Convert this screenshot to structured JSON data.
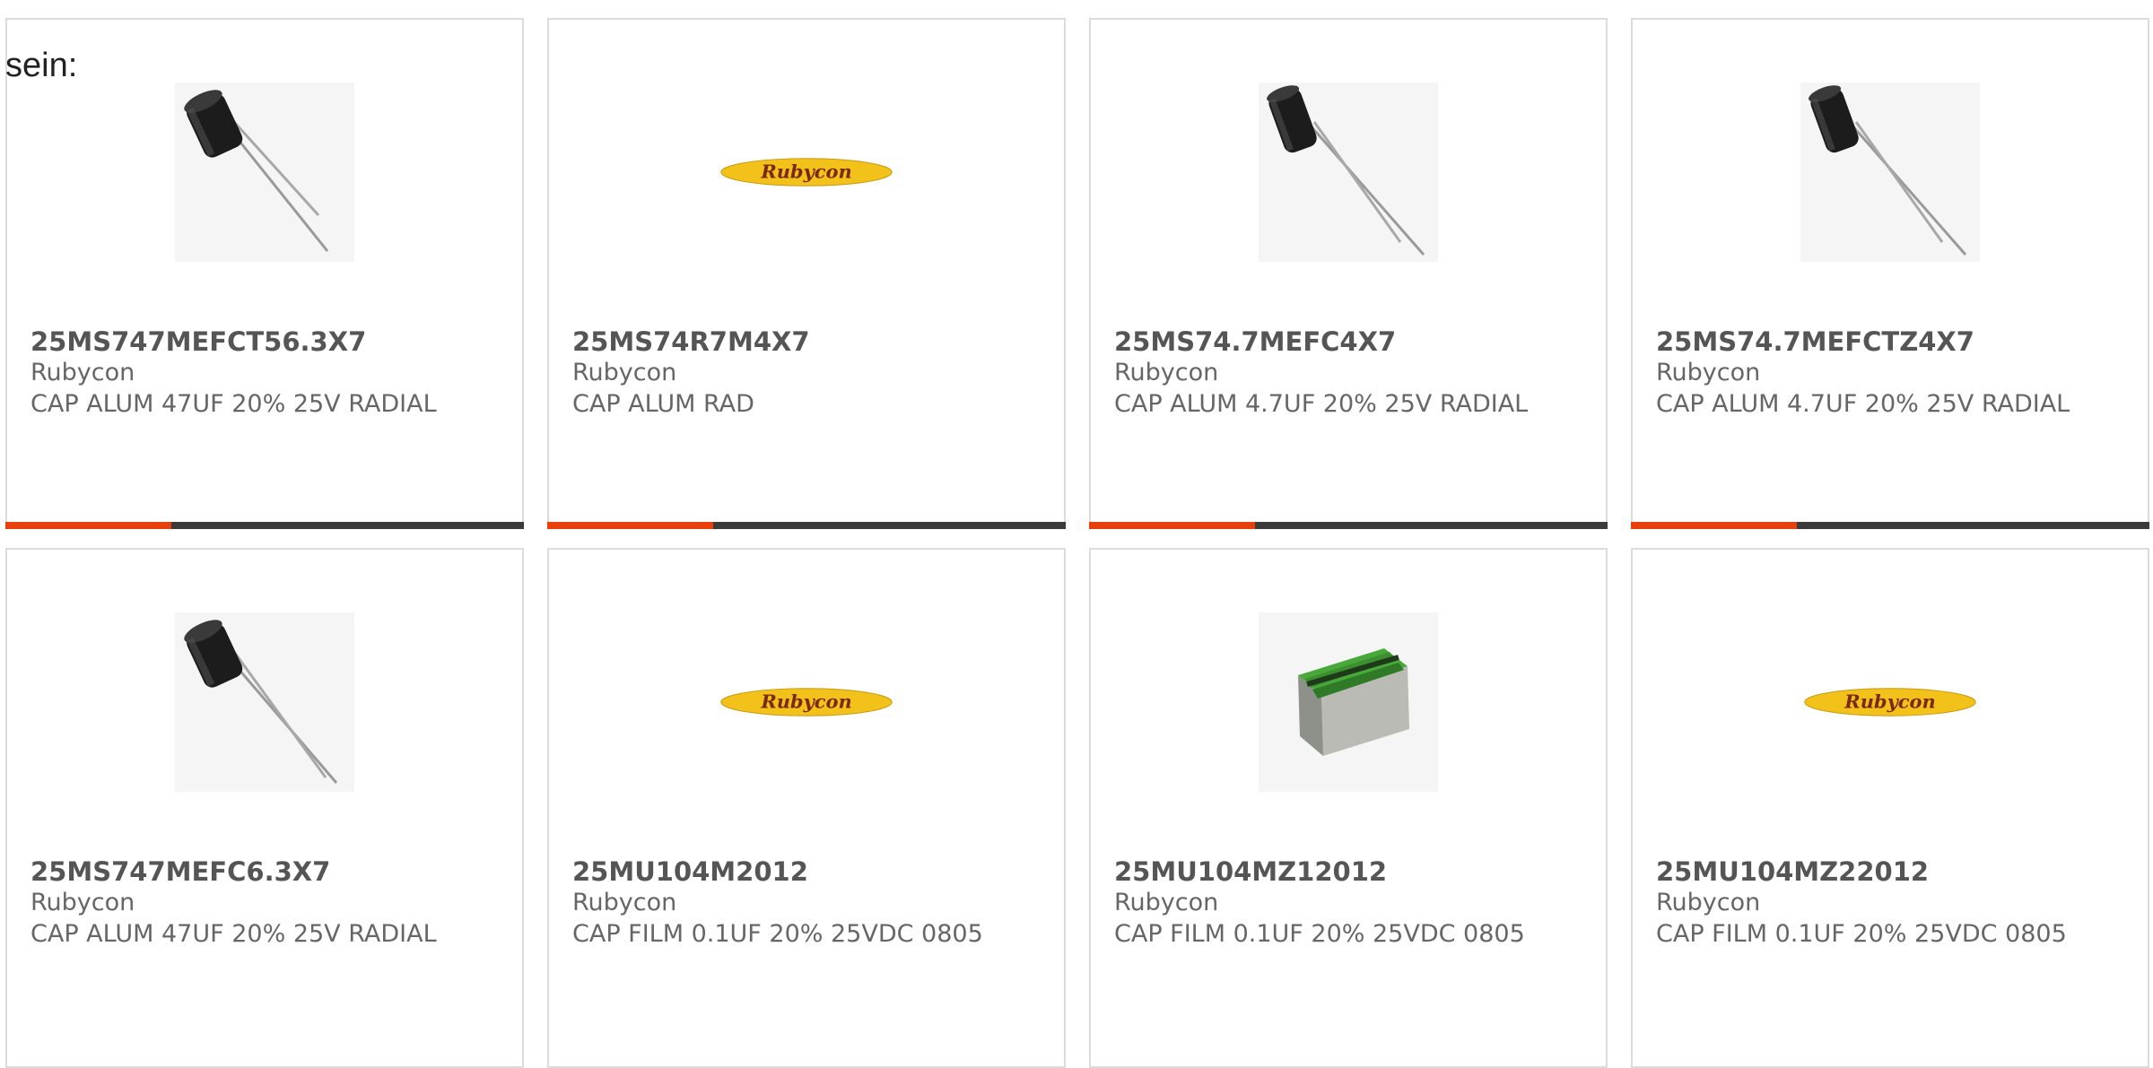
{
  "lead_text": "sein:",
  "products": [
    {
      "part_number": "25MS747MEFCT56.3X7",
      "manufacturer": "Rubycon",
      "description": "CAP ALUM 47UF 20% 25V RADIAL",
      "image": "radial-capacitor-photo"
    },
    {
      "part_number": "25MS74R7M4X7",
      "manufacturer": "Rubycon",
      "description": "CAP ALUM RAD",
      "image": "rubycon-logo",
      "logo_text": "Rubycon"
    },
    {
      "part_number": "25MS74.7MEFC4X7",
      "manufacturer": "Rubycon",
      "description": "CAP ALUM 4.7UF 20% 25V RADIAL",
      "image": "radial-capacitor-photo"
    },
    {
      "part_number": "25MS74.7MEFCTZ4X7",
      "manufacturer": "Rubycon",
      "description": "CAP ALUM 4.7UF 20% 25V RADIAL",
      "image": "radial-capacitor-photo"
    },
    {
      "part_number": "25MS747MEFC6.3X7",
      "manufacturer": "Rubycon",
      "description": "CAP ALUM 47UF 20% 25V RADIAL",
      "image": "radial-capacitor-photo"
    },
    {
      "part_number": "25MU104M2012",
      "manufacturer": "Rubycon",
      "description": "CAP FILM 0.1UF 20% 25VDC 0805",
      "image": "rubycon-logo",
      "logo_text": "Rubycon"
    },
    {
      "part_number": "25MU104MZ12012",
      "manufacturer": "Rubycon",
      "description": "CAP FILM 0.1UF 20% 25VDC 0805",
      "image": "smd-film-capacitor-photo"
    },
    {
      "part_number": "25MU104MZ22012",
      "manufacturer": "Rubycon",
      "description": "CAP FILM 0.1UF 20% 25VDC 0805",
      "image": "rubycon-logo",
      "logo_text": "Rubycon"
    }
  ],
  "slider_progress": 0.32,
  "colors": {
    "accent": "#e8400c",
    "track": "#3b3b3b",
    "card_border": "#dcdcdc",
    "logo_yellow": "#f2c21b",
    "logo_text": "#7a2a12"
  }
}
